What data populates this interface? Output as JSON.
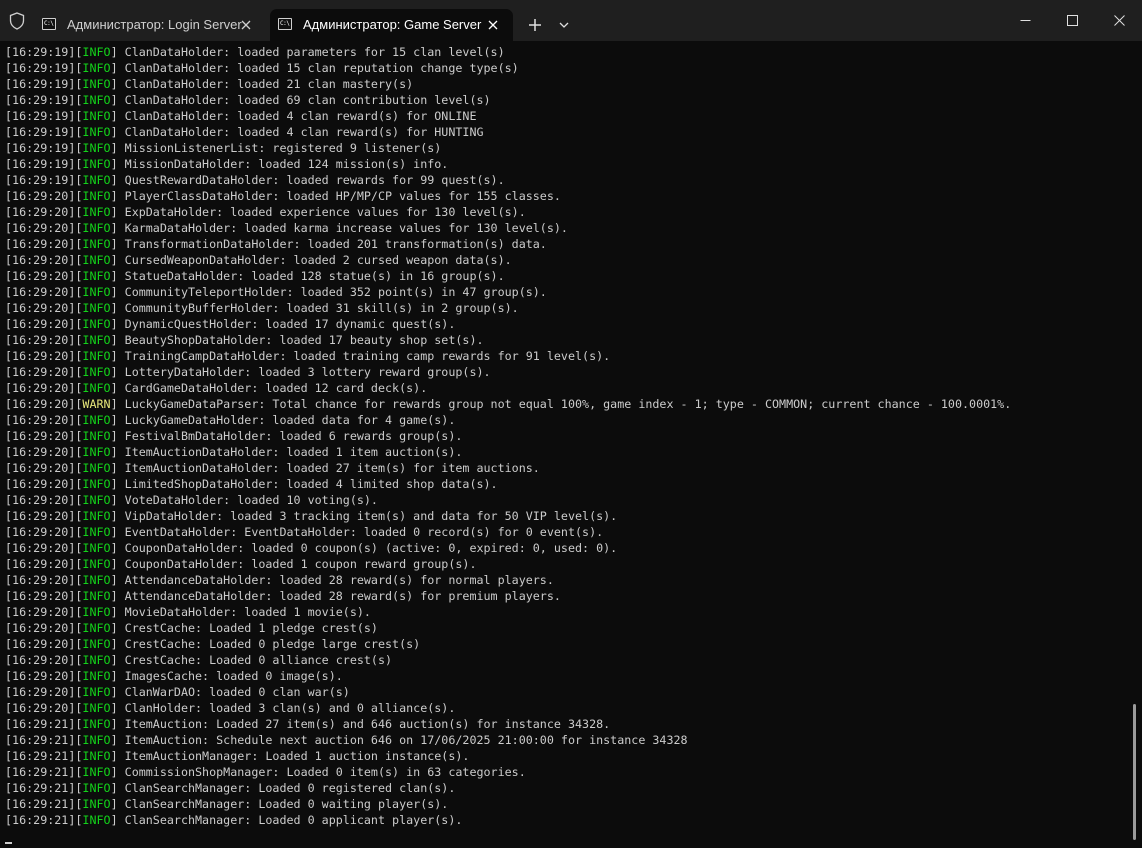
{
  "tabs": [
    {
      "title": "Администратор: Login Server",
      "icon_label": "C:\\",
      "active": false
    },
    {
      "title": "Администратор: Game Server",
      "icon_label": "C:\\",
      "active": true
    }
  ],
  "icons": {
    "shield": "shield-icon",
    "tab": "terminal-icon",
    "close": "close-icon",
    "new_tab": "plus-icon",
    "dropdown": "chevron-down-icon",
    "minimize": "minimize-icon",
    "maximize": "maximize-icon",
    "window_close": "close-icon"
  },
  "colors": {
    "background": "#0c0c0c",
    "text": "#cccccc",
    "info": "#13d31a",
    "warn": "#e6e67a",
    "titlebar": "#1f1f1f"
  },
  "log": [
    {
      "time": "16:29:19",
      "level": "INFO",
      "message": "ClanDataHolder: loaded parameters for 15 clan level(s)"
    },
    {
      "time": "16:29:19",
      "level": "INFO",
      "message": "ClanDataHolder: loaded 15 clan reputation change type(s)"
    },
    {
      "time": "16:29:19",
      "level": "INFO",
      "message": "ClanDataHolder: loaded 21 clan mastery(s)"
    },
    {
      "time": "16:29:19",
      "level": "INFO",
      "message": "ClanDataHolder: loaded 69 clan contribution level(s)"
    },
    {
      "time": "16:29:19",
      "level": "INFO",
      "message": "ClanDataHolder: loaded 4 clan reward(s) for ONLINE"
    },
    {
      "time": "16:29:19",
      "level": "INFO",
      "message": "ClanDataHolder: loaded 4 clan reward(s) for HUNTING"
    },
    {
      "time": "16:29:19",
      "level": "INFO",
      "message": "MissionListenerList: registered 9 listener(s)"
    },
    {
      "time": "16:29:19",
      "level": "INFO",
      "message": "MissionDataHolder: loaded 124 mission(s) info."
    },
    {
      "time": "16:29:19",
      "level": "INFO",
      "message": "QuestRewardDataHolder: loaded rewards for 99 quest(s)."
    },
    {
      "time": "16:29:20",
      "level": "INFO",
      "message": "PlayerClassDataHolder: loaded HP/MP/CP values for 155 classes."
    },
    {
      "time": "16:29:20",
      "level": "INFO",
      "message": "ExpDataHolder: loaded experience values for 130 level(s)."
    },
    {
      "time": "16:29:20",
      "level": "INFO",
      "message": "KarmaDataHolder: loaded karma increase values for 130 level(s)."
    },
    {
      "time": "16:29:20",
      "level": "INFO",
      "message": "TransformationDataHolder: loaded 201 transformation(s) data."
    },
    {
      "time": "16:29:20",
      "level": "INFO",
      "message": "CursedWeaponDataHolder: loaded 2 cursed weapon data(s)."
    },
    {
      "time": "16:29:20",
      "level": "INFO",
      "message": "StatueDataHolder: loaded 128 statue(s) in 16 group(s)."
    },
    {
      "time": "16:29:20",
      "level": "INFO",
      "message": "CommunityTeleportHolder: loaded 352 point(s) in 47 group(s)."
    },
    {
      "time": "16:29:20",
      "level": "INFO",
      "message": "CommunityBufferHolder: loaded 31 skill(s) in 2 group(s)."
    },
    {
      "time": "16:29:20",
      "level": "INFO",
      "message": "DynamicQuestHolder: loaded 17 dynamic quest(s)."
    },
    {
      "time": "16:29:20",
      "level": "INFO",
      "message": "BeautyShopDataHolder: loaded 17 beauty shop set(s)."
    },
    {
      "time": "16:29:20",
      "level": "INFO",
      "message": "TrainingCampDataHolder: loaded training camp rewards for 91 level(s)."
    },
    {
      "time": "16:29:20",
      "level": "INFO",
      "message": "LotteryDataHolder: loaded 3 lottery reward group(s)."
    },
    {
      "time": "16:29:20",
      "level": "INFO",
      "message": "CardGameDataHolder: loaded 12 card deck(s)."
    },
    {
      "time": "16:29:20",
      "level": "WARN",
      "message": "LuckyGameDataParser: Total chance for rewards group not equal 100%, game index - 1; type - COMMON; current chance - 100.0001%."
    },
    {
      "time": "16:29:20",
      "level": "INFO",
      "message": "LuckyGameDataHolder: loaded data for 4 game(s)."
    },
    {
      "time": "16:29:20",
      "level": "INFO",
      "message": "FestivalBmDataHolder: loaded 6 rewards group(s)."
    },
    {
      "time": "16:29:20",
      "level": "INFO",
      "message": "ItemAuctionDataHolder: loaded 1 item auction(s)."
    },
    {
      "time": "16:29:20",
      "level": "INFO",
      "message": "ItemAuctionDataHolder: loaded 27 item(s) for item auctions."
    },
    {
      "time": "16:29:20",
      "level": "INFO",
      "message": "LimitedShopDataHolder: loaded 4 limited shop data(s)."
    },
    {
      "time": "16:29:20",
      "level": "INFO",
      "message": "VoteDataHolder: loaded 10 voting(s)."
    },
    {
      "time": "16:29:20",
      "level": "INFO",
      "message": "VipDataHolder: loaded 3 tracking item(s) and data for 50 VIP level(s)."
    },
    {
      "time": "16:29:20",
      "level": "INFO",
      "message": "EventDataHolder: EventDataHolder: loaded 0 record(s) for 0 event(s)."
    },
    {
      "time": "16:29:20",
      "level": "INFO",
      "message": "CouponDataHolder: loaded 0 coupon(s) (active: 0, expired: 0, used: 0)."
    },
    {
      "time": "16:29:20",
      "level": "INFO",
      "message": "CouponDataHolder: loaded 1 coupon reward group(s)."
    },
    {
      "time": "16:29:20",
      "level": "INFO",
      "message": "AttendanceDataHolder: loaded 28 reward(s) for normal players."
    },
    {
      "time": "16:29:20",
      "level": "INFO",
      "message": "AttendanceDataHolder: loaded 28 reward(s) for premium players."
    },
    {
      "time": "16:29:20",
      "level": "INFO",
      "message": "MovieDataHolder: loaded 1 movie(s)."
    },
    {
      "time": "16:29:20",
      "level": "INFO",
      "message": "CrestCache: Loaded 1 pledge crest(s)"
    },
    {
      "time": "16:29:20",
      "level": "INFO",
      "message": "CrestCache: Loaded 0 pledge large crest(s)"
    },
    {
      "time": "16:29:20",
      "level": "INFO",
      "message": "CrestCache: Loaded 0 alliance crest(s)"
    },
    {
      "time": "16:29:20",
      "level": "INFO",
      "message": "ImagesCache: loaded 0 image(s)."
    },
    {
      "time": "16:29:20",
      "level": "INFO",
      "message": "ClanWarDAO: loaded 0 clan war(s)"
    },
    {
      "time": "16:29:20",
      "level": "INFO",
      "message": "ClanHolder: loaded 3 clan(s) and 0 alliance(s)."
    },
    {
      "time": "16:29:21",
      "level": "INFO",
      "message": "ItemAuction: Loaded 27 item(s) and 646 auction(s) for instance 34328."
    },
    {
      "time": "16:29:21",
      "level": "INFO",
      "message": "ItemAuction: Schedule next auction 646 on 17/06/2025 21:00:00 for instance 34328"
    },
    {
      "time": "16:29:21",
      "level": "INFO",
      "message": "ItemAuctionManager: Loaded 1 auction instance(s)."
    },
    {
      "time": "16:29:21",
      "level": "INFO",
      "message": "CommissionShopManager: Loaded 0 item(s) in 63 categories."
    },
    {
      "time": "16:29:21",
      "level": "INFO",
      "message": "ClanSearchManager: Loaded 0 registered clan(s)."
    },
    {
      "time": "16:29:21",
      "level": "INFO",
      "message": "ClanSearchManager: Loaded 0 waiting player(s)."
    },
    {
      "time": "16:29:21",
      "level": "INFO",
      "message": "ClanSearchManager: Loaded 0 applicant player(s)."
    }
  ]
}
